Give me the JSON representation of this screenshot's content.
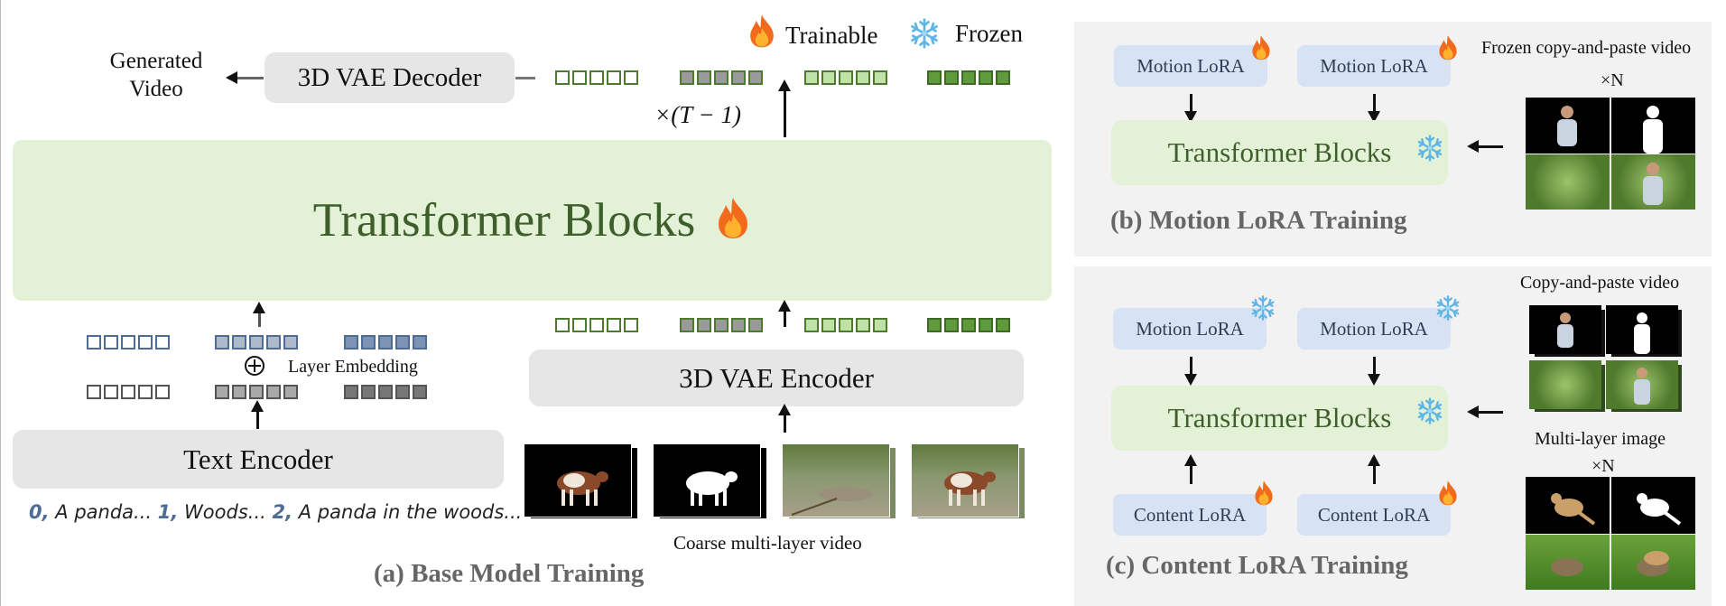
{
  "legend": {
    "trainable": "Trainable",
    "frozen": "Frozen"
  },
  "panel_a": {
    "generated_video": "Generated Video",
    "decoder": "3D VAE Decoder",
    "repeat_label": "×(T − 1)",
    "transformer": "Transformer Blocks",
    "layer_embedding": "Layer Embedding",
    "text_encoder": "Text Encoder",
    "vae_encoder": "3D VAE Encoder",
    "prompt": {
      "idx0": "0,",
      "t0": "A panda...",
      "idx1": "1,",
      "t1": "Woods...",
      "idx2": "2,",
      "t2": "A panda in the woods..."
    },
    "coarse_label": "Coarse multi-layer video",
    "caption": "(a) Base Model Training"
  },
  "panel_b": {
    "lora1": "Motion LoRA",
    "lora2": "Motion LoRA",
    "transformer": "Transformer Blocks",
    "frozen_label": "Frozen copy-and-paste video",
    "times_n": "×N",
    "caption": "(b) Motion LoRA Training"
  },
  "panel_c": {
    "lora1": "Motion LoRA",
    "lora2": "Motion LoRA",
    "transformer": "Transformer Blocks",
    "content1": "Content LoRA",
    "content2": "Content LoRA",
    "video_label": "Copy-and-paste video",
    "image_label": "Multi-layer image",
    "times_n": "×N",
    "caption": "(c) Content LoRA Training"
  },
  "colors": {
    "green_box": "#e3f1d7",
    "gray_box": "#e6e6e6",
    "lora_box": "#d7e3f4",
    "token_green": "#4e7a2d",
    "token_blue": "#4e6c96",
    "panel_bg": "#f2f2f2"
  },
  "icons": [
    "fire-icon",
    "snowflake-icon"
  ]
}
